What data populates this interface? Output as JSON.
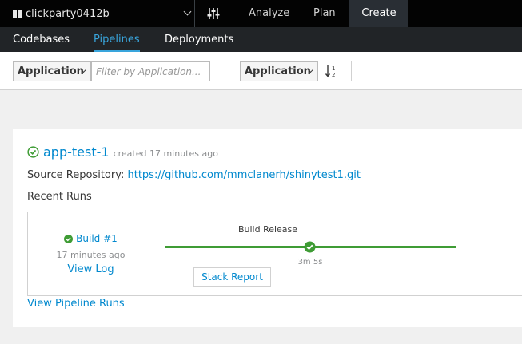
{
  "topbar": {
    "project_name": "clickparty0412b",
    "nav": {
      "analyze": "Analyze",
      "plan": "Plan",
      "create": "Create"
    }
  },
  "subnav": {
    "codebases": "Codebases",
    "pipelines": "Pipelines",
    "deployments": "Deployments",
    "active": "Pipelines"
  },
  "toolbar": {
    "filter_field": "Application",
    "filter_placeholder": "Filter by Application...",
    "sort_field": "Application"
  },
  "pipeline": {
    "name": "app-test-1",
    "created": "created 17 minutes ago",
    "source_label": "Source Repository:",
    "source_url": "https://github.com/mmclanerh/shinytest1.git",
    "recent_runs_label": "Recent Runs",
    "run": {
      "build": "Build #1",
      "time": "17 minutes ago",
      "view_log": "View Log",
      "stage_name": "Build Release",
      "stage_duration": "3m 5s",
      "stack_report": "Stack Report"
    },
    "view_runs": "View Pipeline Runs"
  },
  "colors": {
    "success": "#3f9c35",
    "link": "#0088ce",
    "active_tab": "#39a5dc"
  }
}
